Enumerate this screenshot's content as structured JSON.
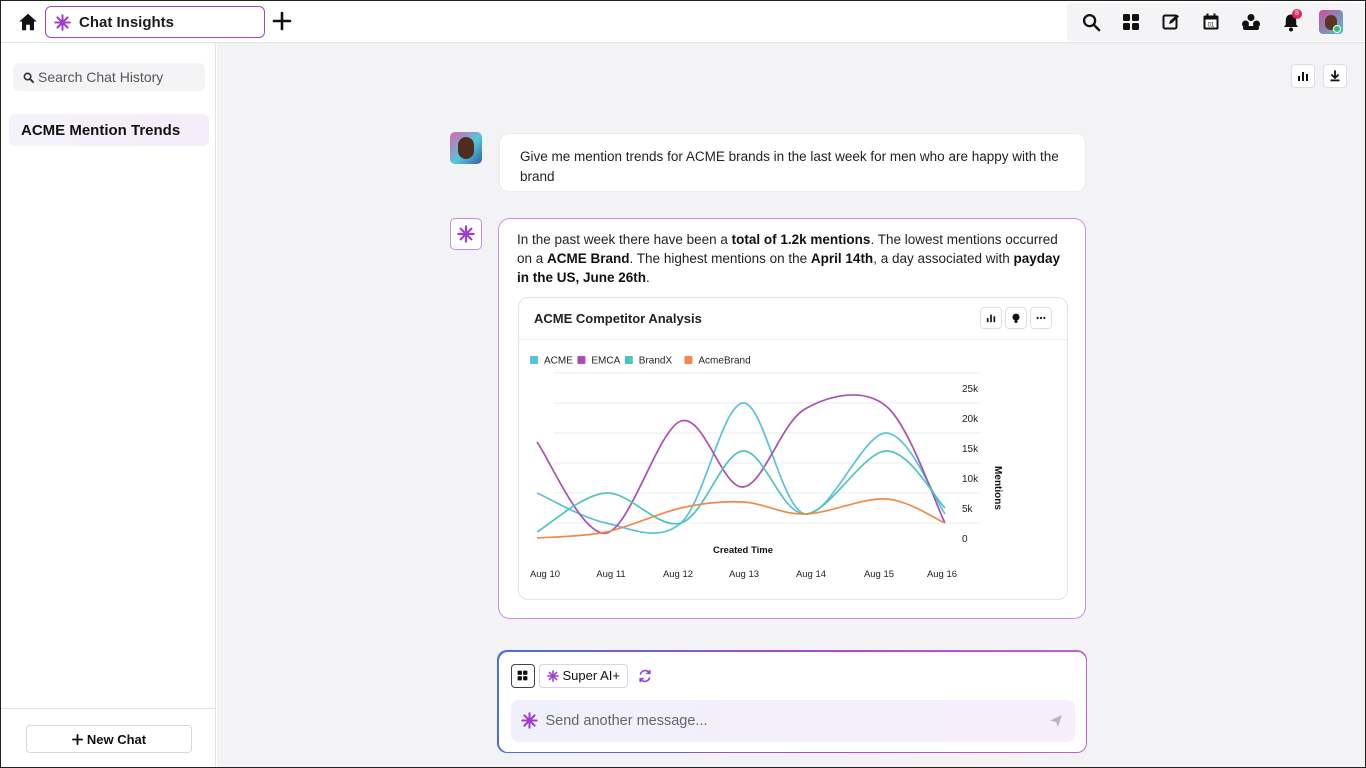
{
  "header": {
    "tab_title": "Chat Insights",
    "notification_count": "8",
    "accent": "#a144c8",
    "icons": [
      "home-icon",
      "sparkle-icon",
      "plus-icon",
      "search-icon",
      "apps-grid-icon",
      "edit-icon",
      "calendar-icon",
      "community-icon",
      "bell-icon",
      "avatar"
    ]
  },
  "sidebar": {
    "search_placeholder": "Search Chat History",
    "history": [
      {
        "label": "ACME Mention Trends"
      }
    ],
    "new_chat_label": "New Chat"
  },
  "conversation": {
    "user_message": "Give me mention trends for ACME brands in the last week for men who are happy with the brand",
    "ai_message": {
      "p1": "In the past week there have been a ",
      "b1": "total of 1.2k mentions",
      "p2": ". The lowest mentions occurred on a ",
      "b2": "ACME Brand",
      "p3": ". The highest mentions on the ",
      "b3": "April 14th",
      "p4": ", a day associated with ",
      "b4": "payday in the US, June 26th",
      "p5": "."
    }
  },
  "chart_card": {
    "title": "ACME Competitor Analysis",
    "icons": [
      "bar-chart-icon",
      "lightbulb-icon",
      "more-icon"
    ]
  },
  "chart_data": {
    "type": "line",
    "title": "ACME Competitor Analysis",
    "xlabel": "Created Time",
    "ylabel": "Mentions",
    "x": [
      "Aug 10",
      "Aug 11",
      "Aug 12",
      "Aug 13",
      "Aug 14",
      "Aug 15",
      "Aug 16"
    ],
    "y_ticks": [
      "0",
      "5k",
      "10k",
      "15k",
      "20k",
      "25k"
    ],
    "ylim": [
      0,
      25000
    ],
    "y_axis_side": "right",
    "legend_position": "top-left",
    "grid": true,
    "series": [
      {
        "name": "ACME",
        "color": "#5bc0de",
        "values": [
          7500,
          2500,
          2500,
          22500,
          4000,
          17500,
          4000
        ]
      },
      {
        "name": "EMCA",
        "color": "#a94fb2",
        "values": [
          16000,
          800,
          19500,
          8500,
          21500,
          22000,
          2500
        ]
      },
      {
        "name": "BrandX",
        "color": "#4ec4bd",
        "values": [
          1000,
          7500,
          2500,
          14500,
          4000,
          14500,
          5000
        ]
      },
      {
        "name": "AcmeBrand",
        "color": "#f08a4b",
        "values": [
          0,
          1000,
          5000,
          6000,
          4000,
          6500,
          2500
        ]
      }
    ]
  },
  "toolbar": {
    "icons": [
      "bar-chart-icon",
      "download-icon"
    ]
  },
  "composer": {
    "model_label": "Super AI+",
    "placeholder": "Send another message..."
  }
}
